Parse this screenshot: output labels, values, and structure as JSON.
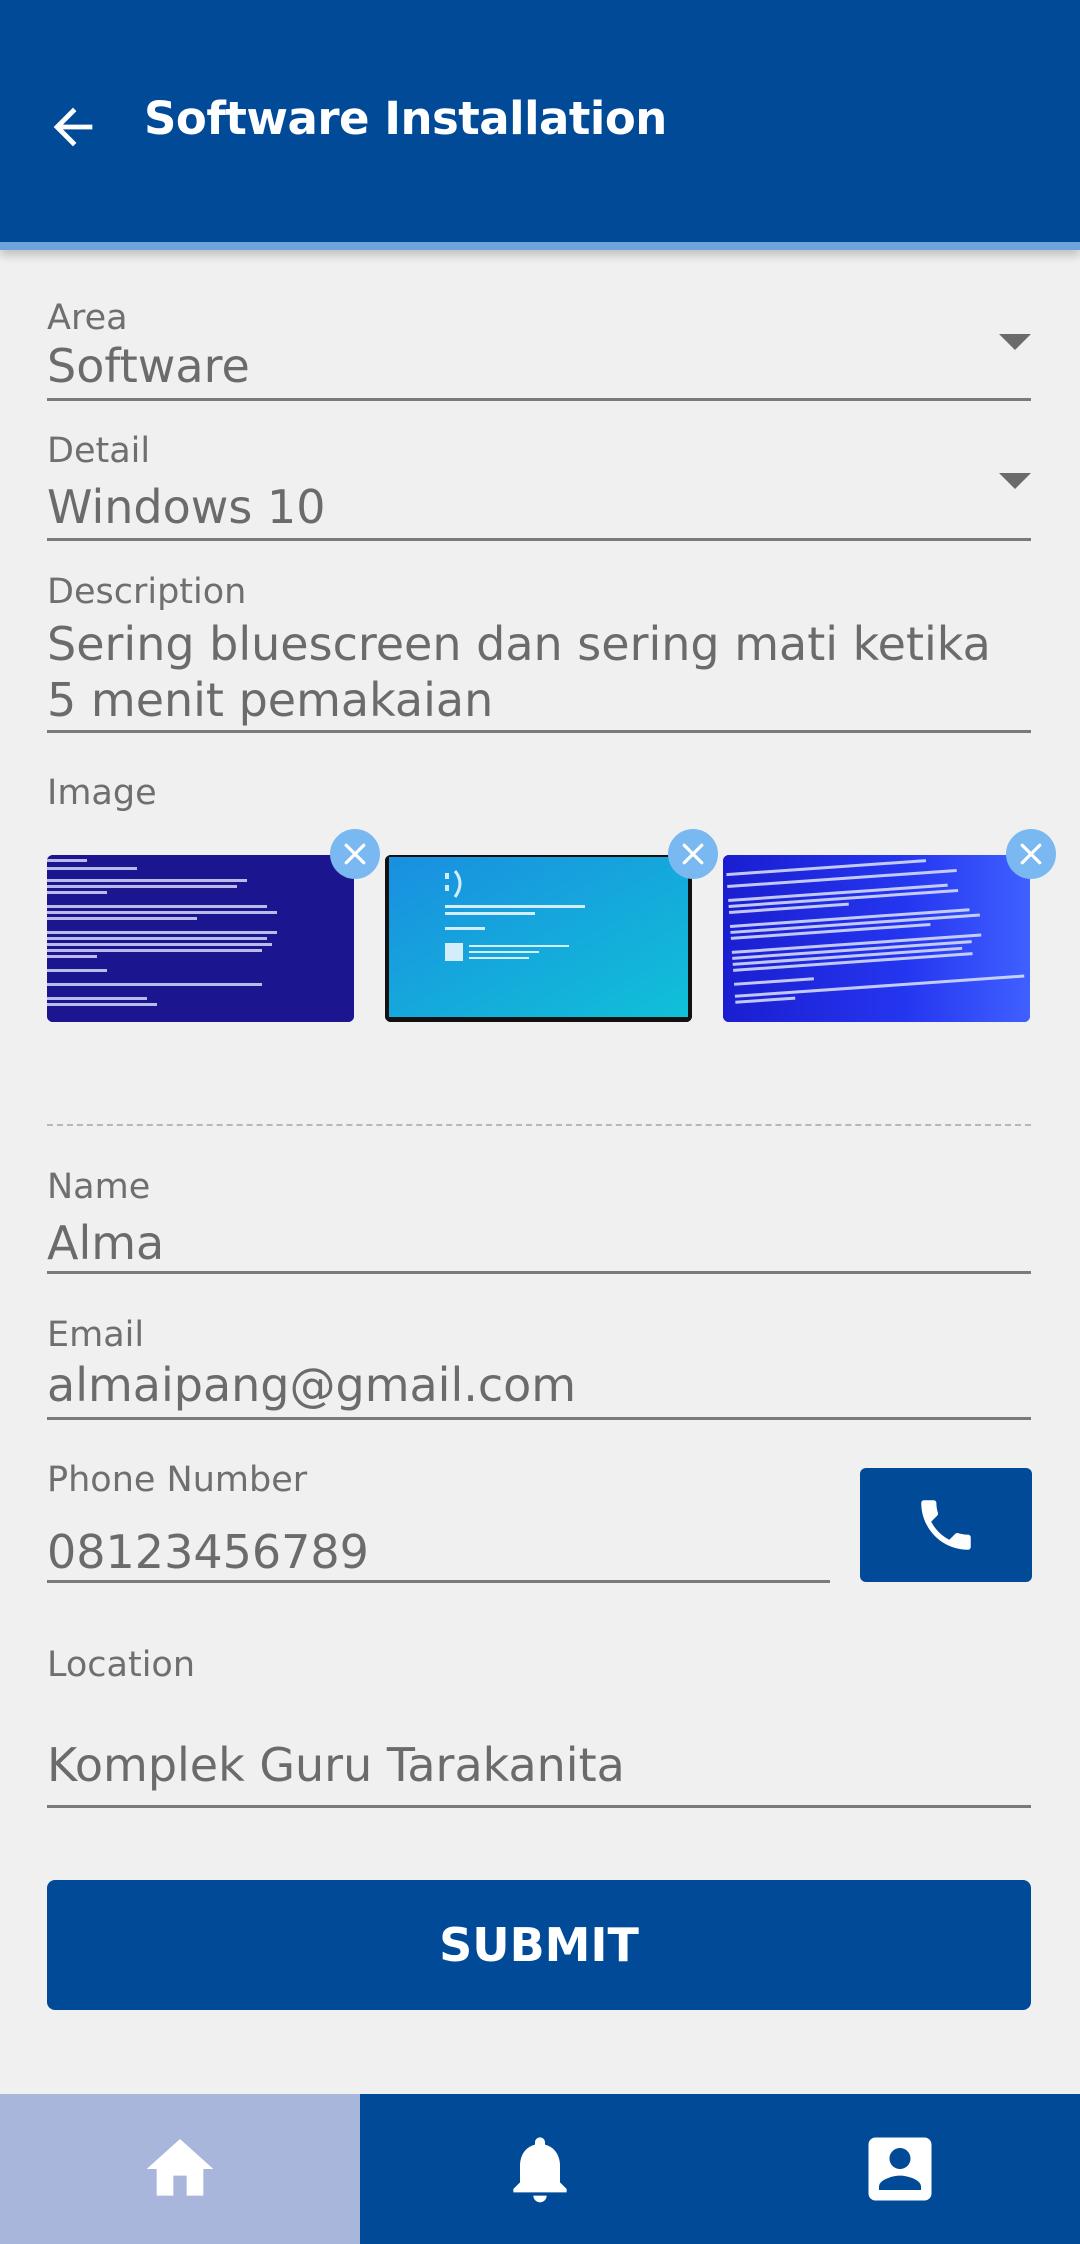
{
  "appbar": {
    "title": "Software Installation"
  },
  "form": {
    "area": {
      "label": "Area",
      "value": "Software"
    },
    "detail": {
      "label": "Detail",
      "value": "Windows 10"
    },
    "description": {
      "label": "Description",
      "line1": "Sering bluescreen dan sering mati ketika",
      "line2": "5 menit pemakaian"
    },
    "image": {
      "label": "Image"
    },
    "name": {
      "label": "Name",
      "value": "Alma"
    },
    "email": {
      "label": "Email",
      "value": "almaipang@gmail.com"
    },
    "phone": {
      "label": "Phone Number",
      "value": "08123456789"
    },
    "location": {
      "label": "Location",
      "value": "Komplek Guru Tarakanita"
    },
    "submit_label": "SUBMIT"
  },
  "icons": {
    "back": "arrow-left-icon",
    "remove": "close-icon",
    "call": "phone-icon",
    "nav": [
      "home-icon",
      "bell-icon",
      "account-box-icon"
    ]
  },
  "colors": {
    "primary": "#004a98",
    "nav_active": "#a9b6dc",
    "remove_badge": "#79b8f0"
  }
}
